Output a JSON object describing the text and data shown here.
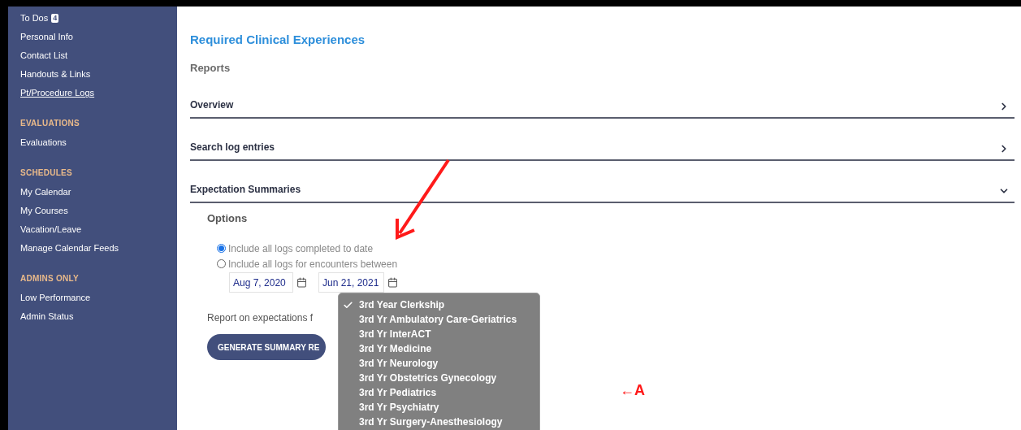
{
  "sidebar": {
    "sections": [
      {
        "items": [
          {
            "label": "To Dos",
            "badge": "4",
            "selected": false
          },
          {
            "label": "Personal Info",
            "selected": false
          },
          {
            "label": "Contact List",
            "selected": false
          },
          {
            "label": "Handouts & Links",
            "selected": false
          },
          {
            "label": "Pt/Procedure Logs",
            "selected": true
          }
        ]
      },
      {
        "heading": "EVALUATIONS",
        "items": [
          {
            "label": "Evaluations",
            "selected": false
          }
        ]
      },
      {
        "heading": "SCHEDULES",
        "items": [
          {
            "label": "My Calendar",
            "selected": false
          },
          {
            "label": "My Courses",
            "selected": false
          },
          {
            "label": "Vacation/Leave",
            "selected": false
          },
          {
            "label": "Manage Calendar Feeds",
            "selected": false
          }
        ]
      },
      {
        "heading": "ADMINS ONLY",
        "items": [
          {
            "label": "Low Performance",
            "selected": false
          },
          {
            "label": "Admin Status",
            "selected": false
          }
        ]
      }
    ]
  },
  "title": "Required Clinical Experiences",
  "subtitle": "Reports",
  "accordion": [
    {
      "label": "Overview",
      "expanded": false
    },
    {
      "label": "Search log entries",
      "expanded": false
    },
    {
      "label": "Expectation Summaries",
      "expanded": true
    }
  ],
  "options": {
    "heading": "Options",
    "radios": [
      {
        "label": "Include all logs completed to date",
        "selected": true
      },
      {
        "label": "Include all logs for encounters between",
        "selected": false
      }
    ],
    "start_date": "Aug 7, 2020",
    "end_date": "Jun 21, 2021",
    "report_label": "Report on expectations f",
    "button": "GENERATE SUMMARY RE"
  },
  "dropdown": [
    {
      "label": "3rd Year Clerkship",
      "selected": true
    },
    {
      "label": "3rd Yr Ambulatory Care-Geriatrics",
      "selected": false
    },
    {
      "label": "3rd Yr InterACT",
      "selected": false
    },
    {
      "label": "3rd Yr Medicine",
      "selected": false
    },
    {
      "label": "3rd Yr Neurology",
      "selected": false
    },
    {
      "label": "3rd Yr Obstetrics Gynecology",
      "selected": false
    },
    {
      "label": "3rd Yr Pediatrics",
      "selected": false
    },
    {
      "label": "3rd Yr Psychiatry",
      "selected": false
    },
    {
      "label": "3rd Yr Surgery-Anesthesiology",
      "selected": false
    }
  ],
  "annotation_label": "←A"
}
